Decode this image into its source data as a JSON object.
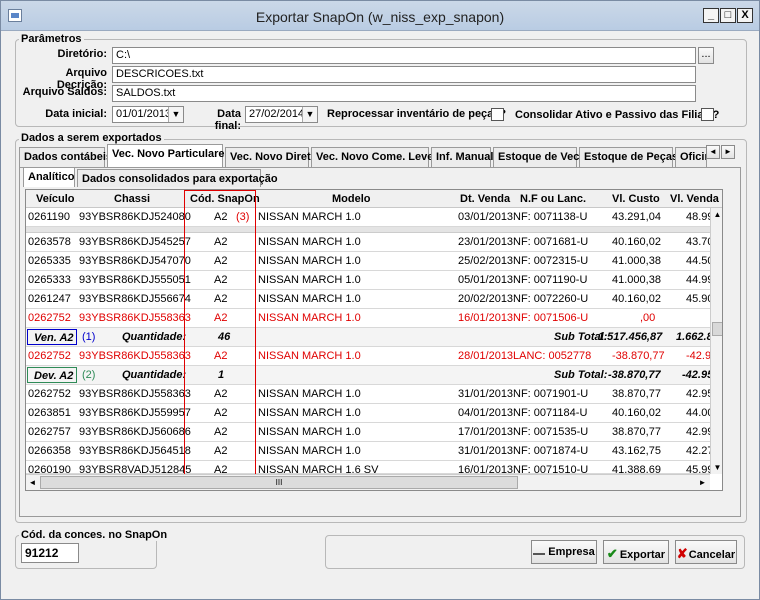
{
  "window": {
    "title": "Exportar SnapOn (w_niss_exp_snapon)",
    "min_label": "_",
    "max_label": "□",
    "close_label": "X"
  },
  "params": {
    "group_label": "Parâmetros",
    "diretorio_label": "Diretório:",
    "diretorio_value": "C:\\",
    "browse_label": "...",
    "descricao_label": "Arquivo Decrição:",
    "descricao_value": "DESCRICOES.txt",
    "saldos_label": "Arquivo Saldos:",
    "saldos_value": "SALDOS.txt",
    "data_inicial_label": "Data inicial:",
    "data_inicial_value": "01/01/2013",
    "data_final_label": "Data final:",
    "data_final_value": "27/02/2014",
    "reprocessar_label": "Reprocessar inventário de peças?",
    "consolidar_label": "Consolidar Ativo e Passivo das Filiais?"
  },
  "export": {
    "group_label": "Dados a serem exportados",
    "tabs": [
      "Dados contábeis",
      "Vec. Novo Particulares",
      "Vec. Novo Direta",
      "Vec. Novo Come. Leves",
      "Inf. Manual",
      "Estoque de Vec.",
      "Estoque de Peças",
      "Oficin"
    ],
    "subtabs": [
      "Analítico",
      "Dados consolidados para exportação"
    ],
    "tab_prev": "◄",
    "tab_next": "►"
  },
  "grid": {
    "columns": [
      "Veículo",
      "Chassi",
      "Cód. SnapOn",
      "Modelo",
      "Dt. Venda",
      "N.F ou Lanc.",
      "Vl. Custo",
      "Vl. Venda"
    ],
    "rows": [
      {
        "veiculo": "0261190",
        "chassi": "93YBSR86KDJ524080",
        "cod": "A2",
        "modelo": "NISSAN MARCH 1.0",
        "dt": "03/01/2013",
        "nf": "NF: 0071138-U",
        "custo": "43.291,04",
        "venda": "48.99"
      },
      {
        "veiculo": "0263578",
        "chassi": "93YBSR86KDJ545257",
        "cod": "A2",
        "modelo": "NISSAN MARCH 1.0",
        "dt": "23/01/2013",
        "nf": "NF: 0071681-U",
        "custo": "40.160,02",
        "venda": "43.70"
      },
      {
        "veiculo": "0265335",
        "chassi": "93YBSR86KDJ547070",
        "cod": "A2",
        "modelo": "NISSAN MARCH 1.0",
        "dt": "25/02/2013",
        "nf": "NF: 0072315-U",
        "custo": "41.000,38",
        "venda": "44.50"
      },
      {
        "veiculo": "0265333",
        "chassi": "93YBSR86KDJ555051",
        "cod": "A2",
        "modelo": "NISSAN MARCH 1.0",
        "dt": "05/01/2013",
        "nf": "NF: 0071190-U",
        "custo": "41.000,38",
        "venda": "44.99"
      },
      {
        "veiculo": "0261247",
        "chassi": "93YBSR86KDJ556674",
        "cod": "A2",
        "modelo": "NISSAN MARCH 1.0",
        "dt": "20/02/2013",
        "nf": "NF: 0072260-U",
        "custo": "40.160,02",
        "venda": "45.90"
      },
      {
        "veiculo": "0262752",
        "chassi": "93YBSR86KDJ558363",
        "cod": "A2",
        "modelo": "NISSAN MARCH 1.0",
        "dt": "16/01/2013",
        "nf": "NF: 0071506-U",
        "custo": ",00",
        "venda": ""
      }
    ],
    "ven_row": {
      "label": "Ven. A2",
      "marker": "(1)",
      "qty_label": "Quantidade:",
      "qty": "46",
      "sub_label": "Sub Total:",
      "custo": "1.517.456,87",
      "venda": "1.662.81"
    },
    "lanc_row": {
      "veiculo": "0262752",
      "chassi": "93YBSR86KDJ558363",
      "cod": "A2",
      "modelo": "NISSAN MARCH 1.0",
      "dt": "28/01/2013",
      "nf": "LANC: 0052778",
      "custo": "-38.870,77",
      "venda": "-42.95"
    },
    "dev_row": {
      "label": "Dev. A2",
      "marker": "(2)",
      "qty_label": "Quantidade:",
      "qty": "1",
      "sub_label": "Sub Total:",
      "custo": "-38.870,77",
      "venda": "-42.95"
    },
    "rows2": [
      {
        "veiculo": "0262752",
        "chassi": "93YBSR86KDJ558363",
        "cod": "A2",
        "modelo": "NISSAN MARCH 1.0",
        "dt": "31/01/2013",
        "nf": "NF: 0071901-U",
        "custo": "38.870,77",
        "venda": "42.95"
      },
      {
        "veiculo": "0263851",
        "chassi": "93YBSR86KDJ559957",
        "cod": "A2",
        "modelo": "NISSAN MARCH 1.0",
        "dt": "04/01/2013",
        "nf": "NF: 0071184-U",
        "custo": "40.160,02",
        "venda": "44.00"
      },
      {
        "veiculo": "0262757",
        "chassi": "93YBSR86KDJ560686",
        "cod": "A2",
        "modelo": "NISSAN MARCH 1.0",
        "dt": "17/01/2013",
        "nf": "NF: 0071535-U",
        "custo": "38.870,77",
        "venda": "42.99"
      },
      {
        "veiculo": "0266358",
        "chassi": "93YBSR86KDJ564518",
        "cod": "A2",
        "modelo": "NISSAN MARCH 1.0",
        "dt": "31/01/2013",
        "nf": "NF: 0071874-U",
        "custo": "43.162,75",
        "venda": "42.27"
      },
      {
        "veiculo": "0260190",
        "chassi": "93YBSR8VADJ512845",
        "cod": "A2",
        "modelo": "NISSAN MARCH 1.6 SV",
        "dt": "16/01/2013",
        "nf": "NF: 0071510-U",
        "custo": "41.388,69",
        "venda": "45.99"
      }
    ],
    "marker3": "(3)",
    "hscroll_thumb": "III"
  },
  "footer": {
    "cod_label": "Cód. da conces. no SnapOn",
    "cod_value": "91212",
    "empresa_label": "Empresa",
    "exportar_label": "Exportar",
    "cancelar_label": "Cancelar"
  },
  "colors": {
    "highlight_red": "#e00000",
    "ven_box": "#0000cc",
    "dev_box": "#2e8b57",
    "snapon_col": "#e00000"
  }
}
